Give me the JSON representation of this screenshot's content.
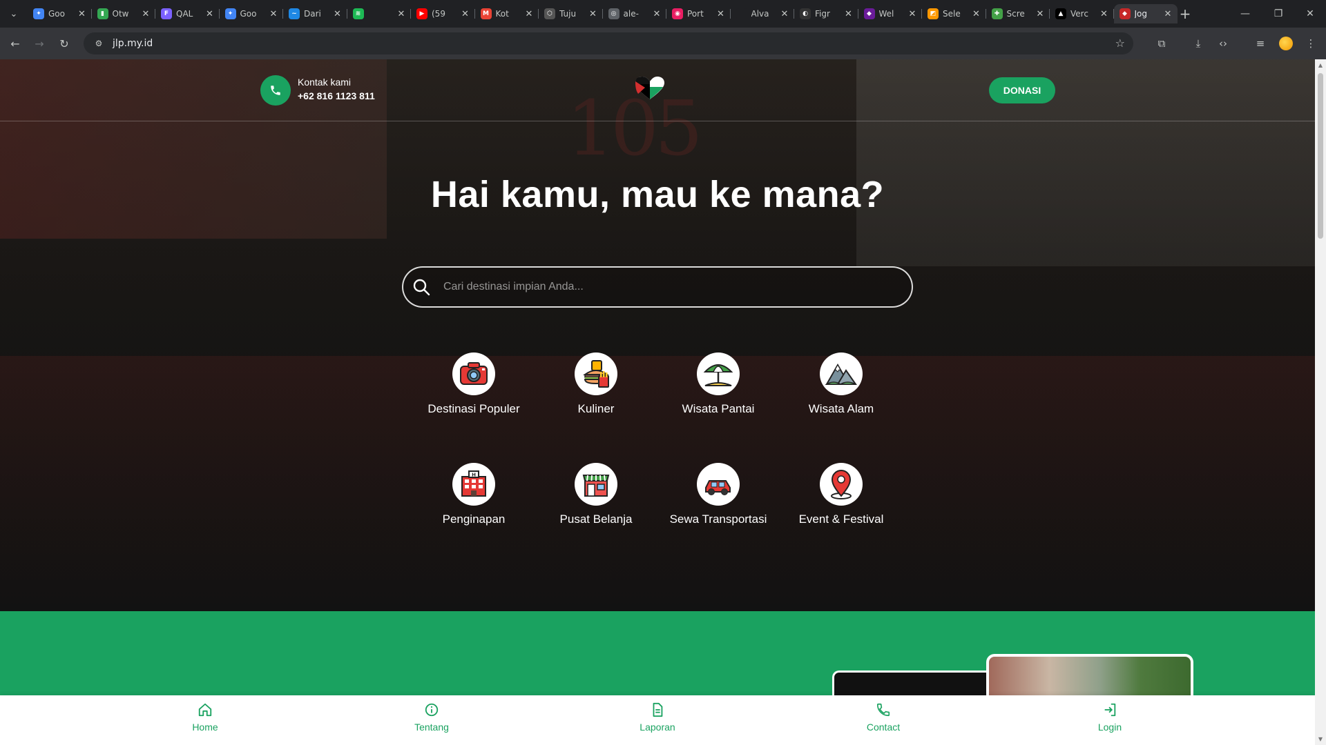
{
  "browser": {
    "tabs": [
      {
        "title": "Goo",
        "color": "#4285f4",
        "glyph": "✦"
      },
      {
        "title": "Otw",
        "color": "#34a853",
        "glyph": "▮"
      },
      {
        "title": "QAL",
        "color": "#7b61ff",
        "glyph": "F"
      },
      {
        "title": "Goo",
        "color": "#4285f4",
        "glyph": "✦"
      },
      {
        "title": "Dari",
        "color": "#1e88e5",
        "glyph": "~"
      },
      {
        "title": "",
        "color": "#1db954",
        "glyph": "≋"
      },
      {
        "title": "(59",
        "color": "#ff0000",
        "glyph": "▶"
      },
      {
        "title": "Kot",
        "color": "#ea4335",
        "glyph": "M"
      },
      {
        "title": "Tuju",
        "color": "#555555",
        "glyph": "⬡"
      },
      {
        "title": "ale-",
        "color": "#5f6368",
        "glyph": "◎"
      },
      {
        "title": "Port",
        "color": "#e91e63",
        "glyph": "◉"
      },
      {
        "title": "Alva",
        "color": "#202124",
        "glyph": ""
      },
      {
        "title": "Figr",
        "color": "#333333",
        "glyph": "◐"
      },
      {
        "title": "Wel",
        "color": "#6a1b9a",
        "glyph": "◆"
      },
      {
        "title": "Sele",
        "color": "#ff9800",
        "glyph": "◩"
      },
      {
        "title": "Scre",
        "color": "#43a047",
        "glyph": "✚"
      },
      {
        "title": "Verc",
        "color": "#000000",
        "glyph": "▲"
      },
      {
        "title": "Jog",
        "color": "#c62828",
        "glyph": "◆"
      }
    ],
    "url": "jlp.my.id"
  },
  "header": {
    "contact_title": "Kontak kami",
    "contact_phone": "+62 816 1123 811",
    "donate_label": "DONASI"
  },
  "hero": {
    "headline": "Hai kamu, mau ke mana?",
    "search_placeholder": "Cari destinasi impian Anda..."
  },
  "categories": [
    {
      "label": "Destinasi Populer",
      "icon": "camera-icon"
    },
    {
      "label": "Kuliner",
      "icon": "food-icon"
    },
    {
      "label": "Wisata Pantai",
      "icon": "beach-umbrella-icon"
    },
    {
      "label": "Wisata Alam",
      "icon": "mountain-icon"
    },
    {
      "label": "Penginapan",
      "icon": "hotel-icon"
    },
    {
      "label": "Pusat Belanja",
      "icon": "shop-icon"
    },
    {
      "label": "Sewa Transportasi",
      "icon": "car-icon"
    },
    {
      "label": "Event & Festival",
      "icon": "location-pin-icon"
    }
  ],
  "bottom_nav": [
    {
      "label": "Home",
      "icon": "home-icon"
    },
    {
      "label": "Tentang",
      "icon": "info-icon"
    },
    {
      "label": "Laporan",
      "icon": "document-icon"
    },
    {
      "label": "Contact",
      "icon": "phone-icon"
    },
    {
      "label": "Login",
      "icon": "login-icon"
    }
  ],
  "colors": {
    "brand_green": "#1aa260",
    "chrome_dark": "#202124",
    "toolbar": "#35363a"
  }
}
